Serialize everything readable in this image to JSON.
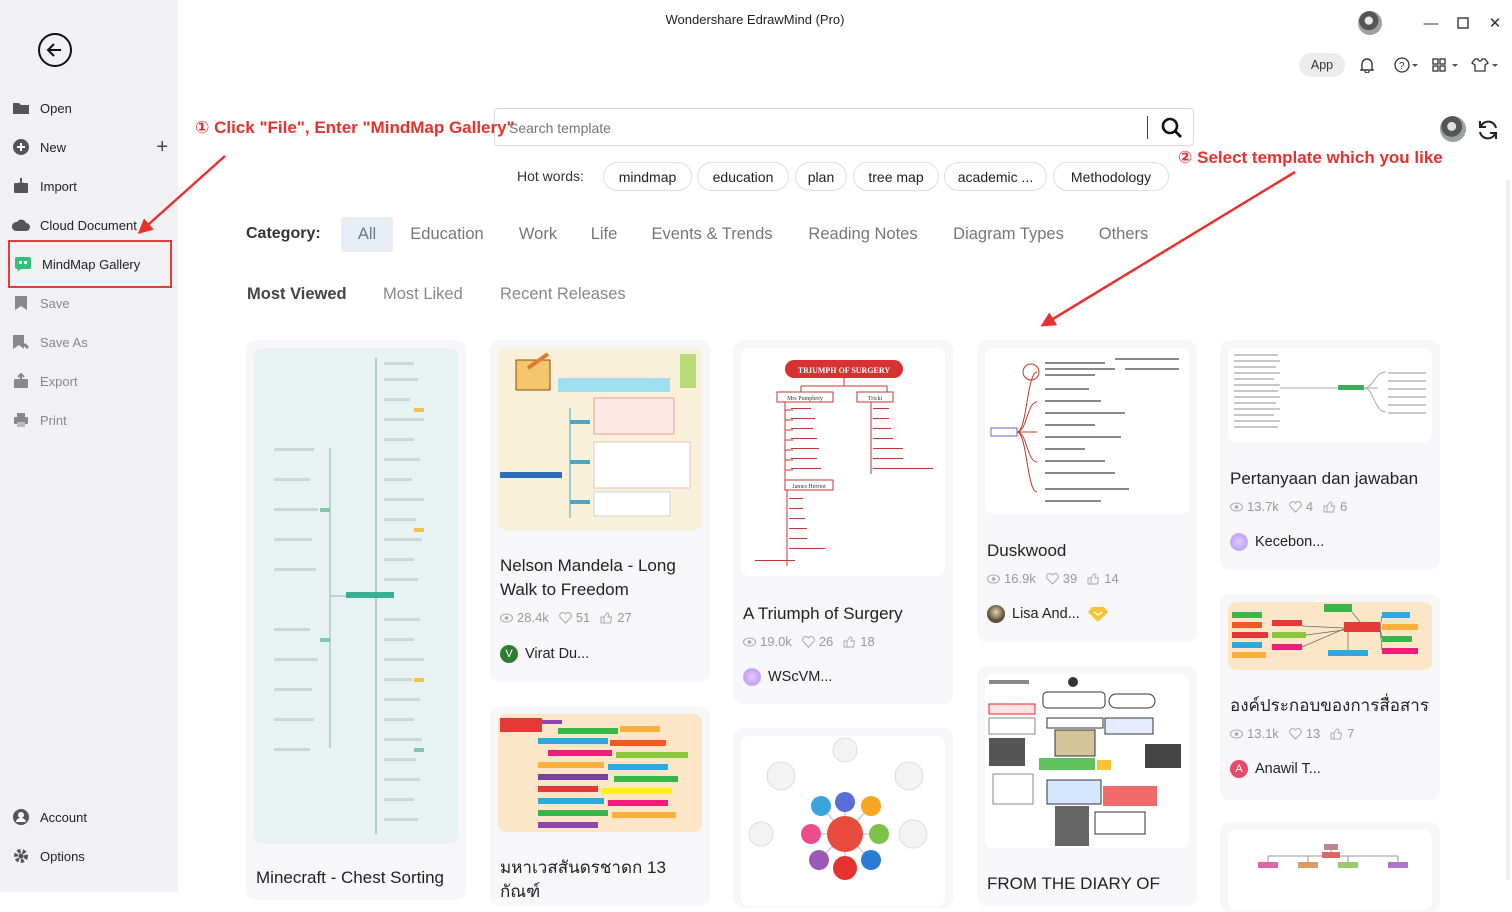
{
  "window": {
    "title": "Wondershare EdrawMind (Pro)",
    "app_label": "App"
  },
  "sidebar": {
    "items": [
      {
        "label": "Open",
        "icon": "folder-icon"
      },
      {
        "label": "New",
        "icon": "plus-circle-icon"
      },
      {
        "label": "Import",
        "icon": "import-icon"
      },
      {
        "label": "Cloud Document",
        "icon": "cloud-icon"
      },
      {
        "label": "MindMap Gallery",
        "icon": "gallery-icon"
      },
      {
        "label": "Save",
        "icon": "save-icon"
      },
      {
        "label": "Save As",
        "icon": "save-as-icon"
      },
      {
        "label": "Export",
        "icon": "export-icon"
      },
      {
        "label": "Print",
        "icon": "print-icon"
      }
    ],
    "bottom": [
      {
        "label": "Account",
        "icon": "account-icon"
      },
      {
        "label": "Options",
        "icon": "gear-icon"
      }
    ]
  },
  "search": {
    "placeholder": "Search template"
  },
  "hot_words": {
    "label": "Hot words:",
    "items": [
      "mindmap",
      "education",
      "plan",
      "tree map",
      "academic ...",
      "Methodology"
    ]
  },
  "category": {
    "label": "Category:",
    "items": [
      "All",
      "Education",
      "Work",
      "Life",
      "Events & Trends",
      "Reading Notes",
      "Diagram Types",
      "Others"
    ],
    "selected": "All"
  },
  "sort": {
    "items": [
      "Most Viewed",
      "Most Liked",
      "Recent Releases"
    ],
    "selected": "Most Viewed"
  },
  "annotations": {
    "step1": "① Click \"File\", Enter \"MindMap Gallery\"",
    "step2": "② Select template which you like"
  },
  "cards": {
    "minecraft": {
      "title": "Minecraft - Chest Sorting"
    },
    "mandela": {
      "title": "Nelson Mandela - Long Walk to Freedom",
      "views": "28.4k",
      "likes": "51",
      "thumbs": "27",
      "author": "Virat Du...",
      "author_initial": "V"
    },
    "thai13": {
      "title": "มหาเวสสันดรชาดก 13 กัณฑ์"
    },
    "surgery": {
      "title": "A Triumph of Surgery",
      "views": "19.0k",
      "likes": "26",
      "thumbs": "18",
      "author": "WScVM..."
    },
    "duskwood": {
      "title": "Duskwood",
      "views": "16.9k",
      "likes": "39",
      "thumbs": "14",
      "author": "Lisa And..."
    },
    "diary": {
      "title": "FROM THE DIARY OF"
    },
    "pertanyaan": {
      "title": "Pertanyaan dan jawaban",
      "views": "13.7k",
      "likes": "4",
      "thumbs": "6",
      "author": "Kecebon..."
    },
    "thai_comm": {
      "title": "องค์ประกอบของการสื่อสาร",
      "views": "13.1k",
      "likes": "13",
      "thumbs": "7",
      "author": "Anawil T...",
      "author_initial": "A"
    }
  },
  "surgery_thumb": {
    "header": "TRIUMPH OF SURGERY",
    "nodes": [
      "Mrs Pumphrey",
      "Tricki",
      "James Herriot"
    ]
  },
  "colors": {
    "annotation": "#e8312f",
    "accent_tab": "#e8eef6",
    "gallery_icon": "#2ec27e"
  }
}
